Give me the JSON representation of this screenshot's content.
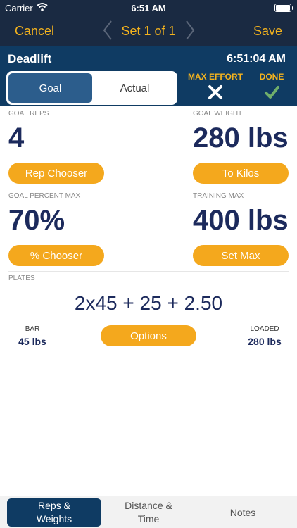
{
  "status_bar": {
    "carrier": "Carrier",
    "time": "6:51 AM"
  },
  "nav": {
    "cancel_label": "Cancel",
    "title": "Set 1 of 1",
    "save_label": "Save"
  },
  "header": {
    "exercise_name": "Deadlift",
    "time": "6:51:04 AM",
    "segment": {
      "goal_label": "Goal",
      "actual_label": "Actual",
      "selected": "Goal"
    },
    "max_effort_label": "MAX EFFORT",
    "done_label": "DONE"
  },
  "goal_reps": {
    "label": "GOAL REPS",
    "value": "4",
    "button_label": "Rep Chooser"
  },
  "goal_weight": {
    "label": "GOAL WEIGHT",
    "value": "280 lbs",
    "button_label": "To Kilos"
  },
  "goal_percent": {
    "label": "GOAL PERCENT MAX",
    "value": "70%",
    "button_label": "% Chooser"
  },
  "training_max": {
    "label": "TRAINING MAX",
    "value": "400 lbs",
    "button_label": "Set Max"
  },
  "plates": {
    "label": "PLATES",
    "value": "2x45 + 25 + 2.50",
    "bar_label": "BAR",
    "bar_value": "45 lbs",
    "options_label": "Options",
    "loaded_label": "LOADED",
    "loaded_value": "280 lbs"
  },
  "tabs": [
    {
      "line1": "Reps &",
      "line2": "Weights"
    },
    {
      "line1": "Distance &",
      "line2": "Time"
    },
    {
      "line1": "Notes",
      "line2": ""
    }
  ],
  "colors": {
    "accent": "#f3b21e",
    "button": "#f4a81d",
    "navy": "#0f3b63",
    "dark_nav": "#1a2a42",
    "value_text": "#1c2a5c",
    "done_check": "#6fae6b"
  },
  "icons": [
    "wifi-icon",
    "battery-icon",
    "chevron-left-icon",
    "chevron-right-icon",
    "close-icon",
    "checkmark-icon"
  ]
}
